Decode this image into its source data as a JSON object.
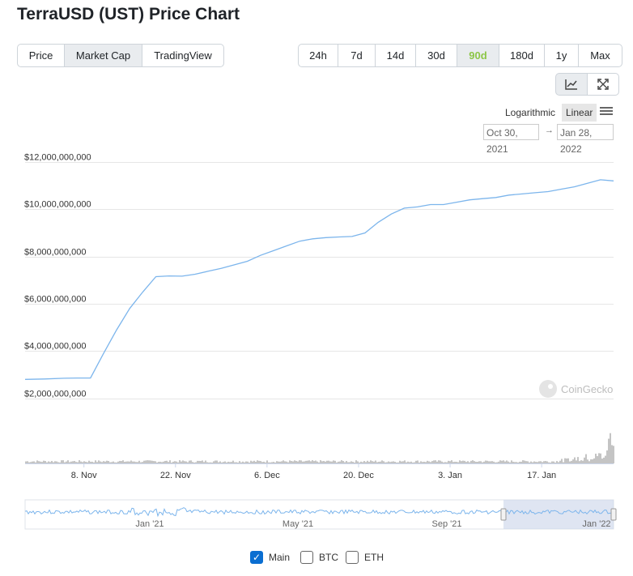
{
  "page": {
    "title": "TerraUSD (UST) Price Chart"
  },
  "view_tabs": [
    {
      "label": "Price",
      "active": false
    },
    {
      "label": "Market Cap",
      "active": true
    },
    {
      "label": "TradingView",
      "active": false
    }
  ],
  "range_tabs": [
    {
      "label": "24h",
      "active": false
    },
    {
      "label": "7d",
      "active": false
    },
    {
      "label": "14d",
      "active": false
    },
    {
      "label": "30d",
      "active": false
    },
    {
      "label": "90d",
      "active": true
    },
    {
      "label": "180d",
      "active": false
    },
    {
      "label": "1y",
      "active": false
    },
    {
      "label": "Max",
      "active": false
    }
  ],
  "toolbar": {
    "line_icon": "line-chart-icon",
    "fullscreen_icon": "expand-icon"
  },
  "scale": {
    "logarithmic": "Logarithmic",
    "linear": "Linear",
    "selected": "Linear"
  },
  "date_range": {
    "from": "Oct 30, 2021",
    "arrow": "→",
    "to": "Jan 28, 2022"
  },
  "watermark": "CoinGecko",
  "colors": {
    "line": "#7cb5ec",
    "volume": "#c4c4c4",
    "active_range": "#8dc647",
    "navigator_mask": "#c9d3ea",
    "checkbox": "#0a6ed1"
  },
  "chart_data": {
    "type": "line",
    "title": "",
    "ylabel": "",
    "xlabel": "",
    "y_scale": "linear",
    "ylim": [
      0,
      12000000000
    ],
    "y_ticks": [
      {
        "value": 2000000000,
        "label": "$2,000,000,000"
      },
      {
        "value": 4000000000,
        "label": "$4,000,000,000"
      },
      {
        "value": 6000000000,
        "label": "$6,000,000,000"
      },
      {
        "value": 8000000000,
        "label": "$8,000,000,000"
      },
      {
        "value": 10000000000,
        "label": "$10,000,000,000"
      },
      {
        "value": 12000000000,
        "label": "$12,000,000,000"
      }
    ],
    "xlim": [
      "2021-10-30",
      "2022-01-28"
    ],
    "x_ticks": [
      {
        "date": "2021-11-08",
        "label": "8. Nov"
      },
      {
        "date": "2021-11-22",
        "label": "22. Nov"
      },
      {
        "date": "2021-12-06",
        "label": "6. Dec"
      },
      {
        "date": "2021-12-20",
        "label": "20. Dec"
      },
      {
        "date": "2022-01-03",
        "label": "3. Jan"
      },
      {
        "date": "2022-01-17",
        "label": "17. Jan"
      }
    ],
    "series": [
      {
        "x": [
          "2021-10-30",
          "2021-11-02",
          "2021-11-05",
          "2021-11-07",
          "2021-11-09",
          "2021-11-11",
          "2021-11-13",
          "2021-11-15",
          "2021-11-17",
          "2021-11-19",
          "2021-11-21",
          "2021-11-23",
          "2021-11-25",
          "2021-11-27",
          "2021-11-29",
          "2021-12-01",
          "2021-12-03",
          "2021-12-05",
          "2021-12-07",
          "2021-12-09",
          "2021-12-11",
          "2021-12-13",
          "2021-12-15",
          "2021-12-17",
          "2021-12-19",
          "2021-12-21",
          "2021-12-23",
          "2021-12-25",
          "2021-12-27",
          "2021-12-29",
          "2021-12-31",
          "2022-01-02",
          "2022-01-04",
          "2022-01-06",
          "2022-01-08",
          "2022-01-10",
          "2022-01-12",
          "2022-01-14",
          "2022-01-16",
          "2022-01-18",
          "2022-01-20",
          "2022-01-22",
          "2022-01-24",
          "2022-01-26",
          "2022-01-28"
        ],
        "values": [
          2800000000,
          2820000000,
          2850000000,
          2860000000,
          2860000000,
          3900000000,
          4900000000,
          5800000000,
          6500000000,
          7150000000,
          7180000000,
          7170000000,
          7250000000,
          7380000000,
          7500000000,
          7650000000,
          7800000000,
          8050000000,
          8250000000,
          8450000000,
          8650000000,
          8750000000,
          8800000000,
          8830000000,
          8850000000,
          9000000000,
          9450000000,
          9800000000,
          10050000000,
          10100000000,
          10200000000,
          10200000000,
          10300000000,
          10400000000,
          10450000000,
          10500000000,
          10600000000,
          10650000000,
          10700000000,
          10750000000,
          10850000000,
          10950000000,
          11100000000,
          11250000000,
          11200000000
        ]
      }
    ],
    "volume_note": "",
    "navigator": {
      "x_ticks": [
        "Jan '21",
        "May '21",
        "Sep '21",
        "Jan '22"
      ]
    }
  },
  "series_checks": [
    {
      "label": "Main",
      "checked": true
    },
    {
      "label": "BTC",
      "checked": false
    },
    {
      "label": "ETH",
      "checked": false
    }
  ]
}
